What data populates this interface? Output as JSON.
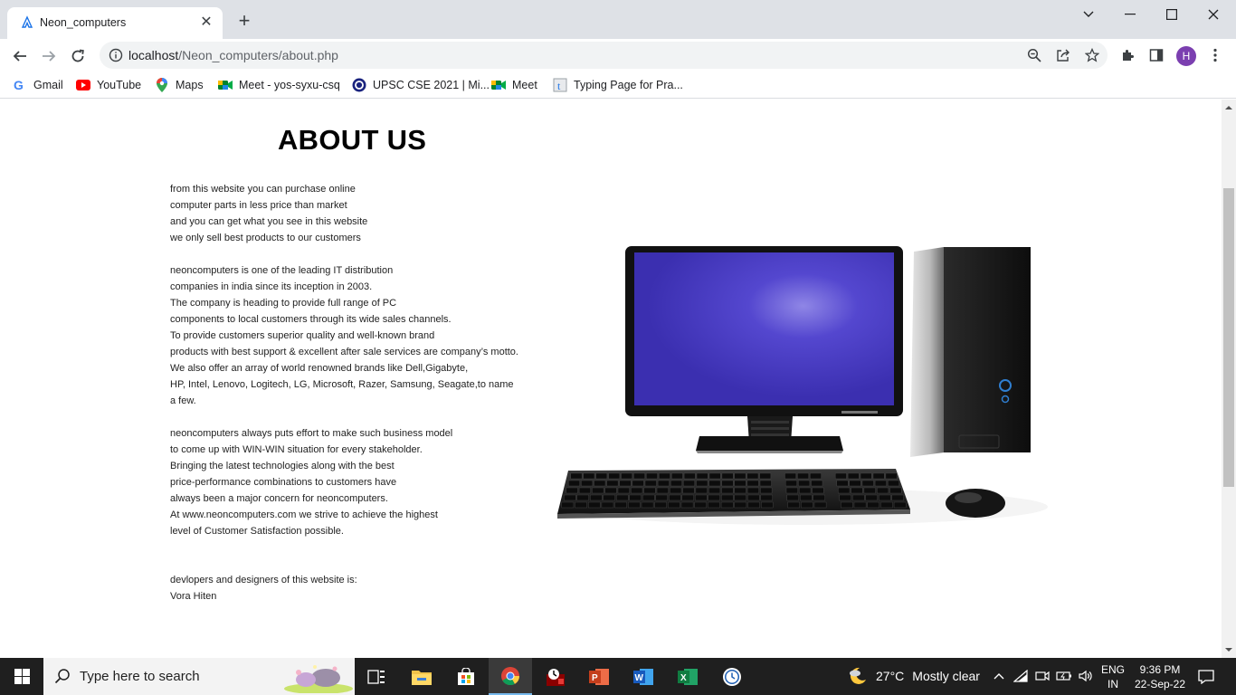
{
  "browser": {
    "tab": {
      "title": "Neon_computers",
      "close_label": "✕"
    },
    "new_tab_label": "+",
    "address": {
      "host": "localhost",
      "path": "/Neon_computers/about.php"
    },
    "avatar_letter": "H",
    "bookmarks": [
      {
        "label": "Gmail",
        "icon": "gmail-icon"
      },
      {
        "label": "YouTube",
        "icon": "youtube-icon"
      },
      {
        "label": "Maps",
        "icon": "maps-icon"
      },
      {
        "label": "Meet - yos-syxu-csq",
        "icon": "meet-icon"
      },
      {
        "label": "UPSC CSE 2021 | Mi...",
        "icon": "upsc-icon"
      },
      {
        "label": "Meet",
        "icon": "meet-icon"
      },
      {
        "label": "Typing Page for Pra...",
        "icon": "typing-icon"
      }
    ]
  },
  "page": {
    "heading": "ABOUT US",
    "paragraph1": [
      "from this website you can purchase online",
      "computer parts in less price than market",
      "and you can get what you see in this website",
      "we only sell best products to our customers"
    ],
    "paragraph2": [
      "neoncomputers is one of the leading IT distribution",
      "companies in india since its inception in 2003.",
      "The company is heading to provide full range of PC",
      "components to local customers through its wide sales channels.",
      "To provide customers superior quality and well-known brand",
      "products with best support & excellent after sale services are company’s motto.",
      "We also offer an array of world renowned brands like Dell,Gigabyte,",
      "HP, Intel, Lenovo, Logitech, LG, Microsoft, Razer, Samsung, Seagate,to name",
      "a few."
    ],
    "paragraph3": [
      "neoncomputers always puts effort to make such business model",
      "to come up with WIN-WIN situation for every stakeholder.",
      "Bringing the latest technologies along with the best",
      "price-performance combinations to customers have",
      "always been a major concern for neoncomputers.",
      "At www.neoncomputers.com we strive to achieve the highest",
      "level of Customer Satisfaction possible."
    ],
    "credits": [
      "devlopers and designers of this website is:",
      "Vora Hiten"
    ],
    "image_alt": "desktop computer with monitor, tower, keyboard and mouse"
  },
  "taskbar": {
    "search_placeholder": "Type here to search",
    "weather": {
      "temp": "27°C",
      "condition": "Mostly clear"
    },
    "lang": [
      "ENG",
      "IN"
    ],
    "time": "9:36 PM",
    "date": "22-Sep-22",
    "apps": [
      "task-view-icon",
      "file-explorer-icon",
      "store-icon",
      "chrome-icon",
      "app-icon",
      "powerpoint-icon",
      "word-icon",
      "excel-icon",
      "clock-app-icon"
    ]
  },
  "colors": {
    "tabbar_bg": "#dee1e6",
    "avatar": "#7b3fb0",
    "screen": "#4a3fc4",
    "taskbar_bg": "#1f1f1f"
  }
}
